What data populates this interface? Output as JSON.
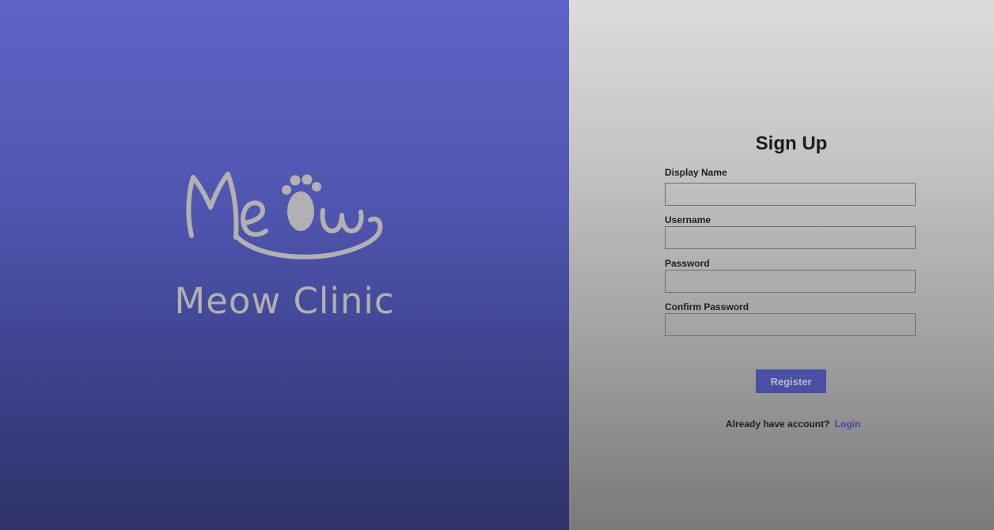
{
  "brand": {
    "logo_text": "Meow",
    "name": "Meow Clinic"
  },
  "form": {
    "title": "Sign Up",
    "fields": [
      {
        "label": "Display Name",
        "value": "",
        "placeholder": ""
      },
      {
        "label": "Username",
        "value": "",
        "placeholder": ""
      },
      {
        "label": "Password",
        "value": "",
        "placeholder": ""
      },
      {
        "label": "Confirm Password",
        "value": "",
        "placeholder": ""
      }
    ],
    "submit_label": "Register",
    "login_prompt": "Already have account?",
    "login_link": "Login"
  },
  "colors": {
    "brand_panel_top": "#5d64c6",
    "brand_panel_bottom": "#2f3368",
    "accent": "#4a4fa3",
    "logo_gray": "#b1b1b1",
    "link": "#3c44a8"
  },
  "icons": {
    "logo": "meow-logo-icon",
    "paw": "paw-icon"
  }
}
